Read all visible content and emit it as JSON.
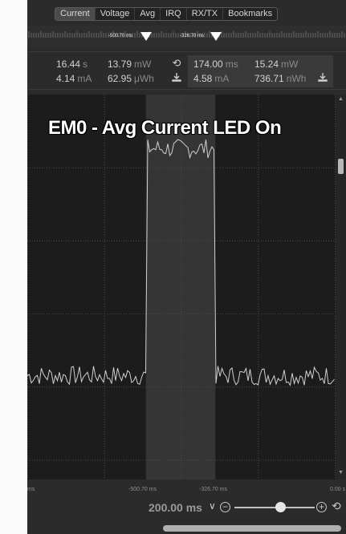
{
  "tabs": [
    "Current",
    "Voltage",
    "Avg",
    "IRQ",
    "RX/TX",
    "Bookmarks"
  ],
  "active_tab": "Current",
  "cursors": {
    "a_time": "-500.70 ms",
    "b_time": "-326.70 ms"
  },
  "stats_global": {
    "time": {
      "value": "16.44",
      "unit": "s"
    },
    "power": {
      "value": "13.79",
      "unit": "mW"
    },
    "current": {
      "value": "4.14",
      "unit": "mA"
    },
    "energy": {
      "value": "62.95",
      "unit": "μWh"
    }
  },
  "stats_selection": {
    "time": {
      "value": "174.00",
      "unit": "ms"
    },
    "power": {
      "value": "15.24",
      "unit": "mW"
    },
    "current": {
      "value": "4.58",
      "unit": "mA"
    },
    "energy": {
      "value": "736.71",
      "unit": "nWh"
    }
  },
  "plot": {
    "annotation": "EM0 - Avg Current LED On",
    "waveform": {
      "baseline_level": 0.27,
      "on_level": 0.86,
      "noise": 0.025,
      "on_start": 0.385,
      "on_end": 0.61
    }
  },
  "x_axis_labels": {
    "left": "ms",
    "a": "-500.70 ms",
    "b": "-326.70 ms",
    "right": "0.00 s"
  },
  "zoom": {
    "value": "200.00",
    "unit": "ms"
  },
  "colors": {
    "plot_bg": "#1c1c1c",
    "trace": "#d0d0d0",
    "selection": "#3e3e3e"
  }
}
